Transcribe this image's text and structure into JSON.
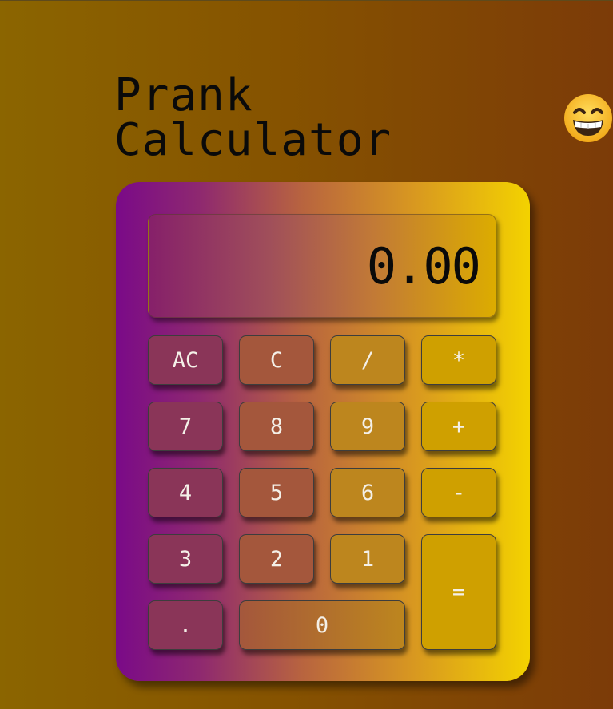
{
  "app": {
    "title": "Prank Calculator",
    "emoji_icon": "grinning-face-with-smiling-eyes"
  },
  "display": {
    "value": "0.00"
  },
  "keys": {
    "ac": "AC",
    "c": "C",
    "divide": "/",
    "multiply": "*",
    "seven": "7",
    "eight": "8",
    "nine": "9",
    "plus": "+",
    "four": "4",
    "five": "5",
    "six": "6",
    "minus": "-",
    "three": "3",
    "two": "2",
    "one": "1",
    "equals": "=",
    "decimal": ".",
    "zero": "0"
  },
  "colors": {
    "calculator_gradient_start": "#7a0a88",
    "calculator_gradient_end": "#f3d200",
    "background_left": "#8b6500",
    "background_right": "#7c3b08"
  }
}
